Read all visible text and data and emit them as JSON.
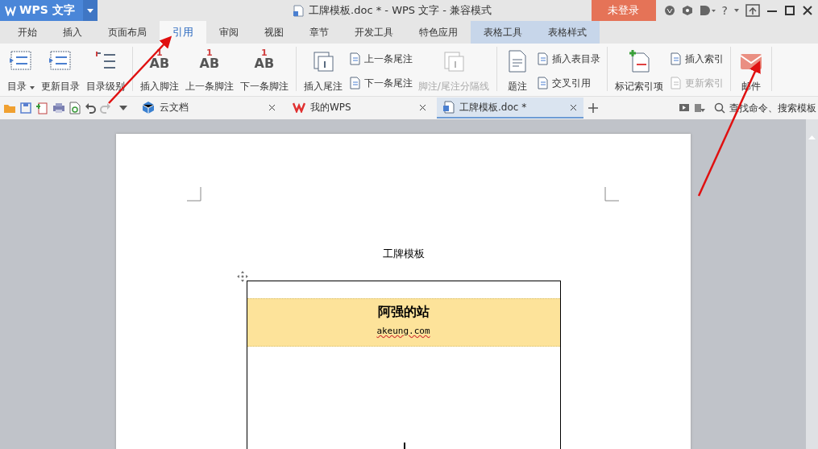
{
  "app_button": {
    "label": "WPS 文字"
  },
  "window": {
    "title": "工牌模板.doc * - WPS 文字 - 兼容模式"
  },
  "login_button": {
    "label": "未登录"
  },
  "help_button": {
    "label": "?"
  },
  "ribbon_tabs": [
    {
      "label": "开始",
      "selected": false,
      "kind": "normal"
    },
    {
      "label": "插入",
      "selected": false,
      "kind": "normal"
    },
    {
      "label": "页面布局",
      "selected": false,
      "kind": "normal"
    },
    {
      "label": "引用",
      "selected": true,
      "kind": "normal"
    },
    {
      "label": "审阅",
      "selected": false,
      "kind": "normal"
    },
    {
      "label": "视图",
      "selected": false,
      "kind": "normal"
    },
    {
      "label": "章节",
      "selected": false,
      "kind": "normal"
    },
    {
      "label": "开发工具",
      "selected": false,
      "kind": "normal"
    },
    {
      "label": "特色应用",
      "selected": false,
      "kind": "normal"
    },
    {
      "label": "表格工具",
      "selected": false,
      "kind": "context"
    },
    {
      "label": "表格样式",
      "selected": false,
      "kind": "context"
    }
  ],
  "ribbon_groups": [
    {
      "items": [
        {
          "kind": "large",
          "label": "目录",
          "caret": true,
          "disabled": false
        },
        {
          "kind": "large",
          "label": "更新目录",
          "disabled": false
        },
        {
          "kind": "large",
          "label": "目录级别",
          "disabled": false
        }
      ]
    },
    {
      "items": [
        {
          "kind": "large",
          "label": "插入脚注",
          "icon_text": "AB",
          "icon_mark": "1",
          "disabled": false
        },
        {
          "kind": "large",
          "label": "上一条脚注",
          "icon_text": "AB",
          "icon_mark": "1",
          "disabled": false
        },
        {
          "kind": "large",
          "label": "下一条脚注",
          "icon_text": "AB",
          "icon_mark": "1",
          "disabled": false
        }
      ]
    },
    {
      "items": [
        {
          "kind": "large",
          "label": "插入尾注",
          "disabled": false
        },
        {
          "kind": "small",
          "label": "上一条尾注",
          "disabled": false
        },
        {
          "kind": "small",
          "label": "下一条尾注",
          "disabled": false
        },
        {
          "kind": "large",
          "label": "脚注/尾注分隔线",
          "disabled": true
        }
      ]
    },
    {
      "items": [
        {
          "kind": "large",
          "label": "题注",
          "disabled": false
        },
        {
          "kind": "small",
          "label": "插入表目录",
          "disabled": false
        },
        {
          "kind": "small",
          "label": "交叉引用",
          "disabled": false
        }
      ]
    },
    {
      "items": [
        {
          "kind": "large",
          "label": "标记索引项",
          "disabled": false
        },
        {
          "kind": "small",
          "label": "插入索引",
          "disabled": false
        },
        {
          "kind": "small",
          "label": "更新索引",
          "disabled": true
        }
      ]
    },
    {
      "items": [
        {
          "kind": "large",
          "label": "邮件",
          "disabled": false
        }
      ]
    }
  ],
  "doc_tabs": [
    {
      "label": "云文档",
      "selected": false
    },
    {
      "label": "我的WPS",
      "selected": false
    },
    {
      "label": "工牌模板.doc *",
      "selected": true
    }
  ],
  "search": {
    "placeholder": "查找命令、搜索模板"
  },
  "document": {
    "title": "工牌模板",
    "badge_name": "阿强的站",
    "badge_url": "akeung.com"
  }
}
